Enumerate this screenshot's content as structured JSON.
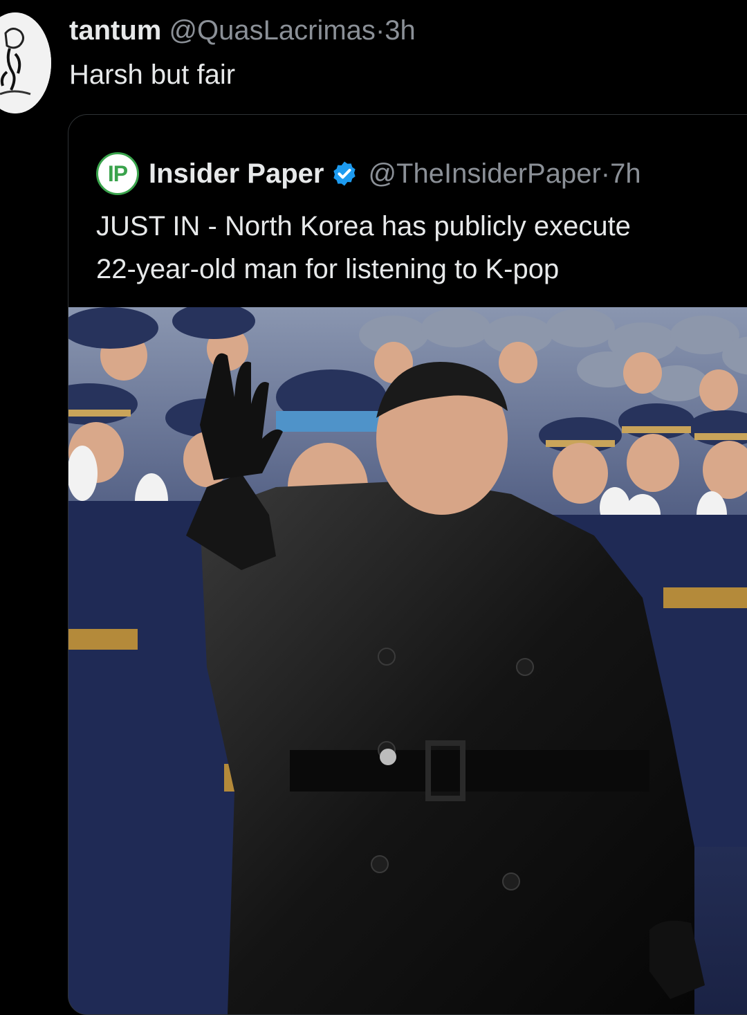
{
  "tweet": {
    "display_name": "tantum",
    "handle": "@QuasLacrimas",
    "separator": "·",
    "time": "3h",
    "text": "Harsh but fair"
  },
  "quoted": {
    "logo_text": "IP",
    "display_name": "Insider Paper",
    "verified_icon": "verified-badge-icon",
    "handle": "@TheInsiderPaper",
    "separator": "·",
    "time": "7h",
    "text_line1": "JUST IN - North Korea has publicly execute",
    "text_line2": "22-year-old man for listening to K-pop"
  },
  "colors": {
    "background": "#000000",
    "text": "#e7e9ea",
    "secondary_text": "#8b9097",
    "verified": "#1d9bf0",
    "border": "#2f3336"
  }
}
